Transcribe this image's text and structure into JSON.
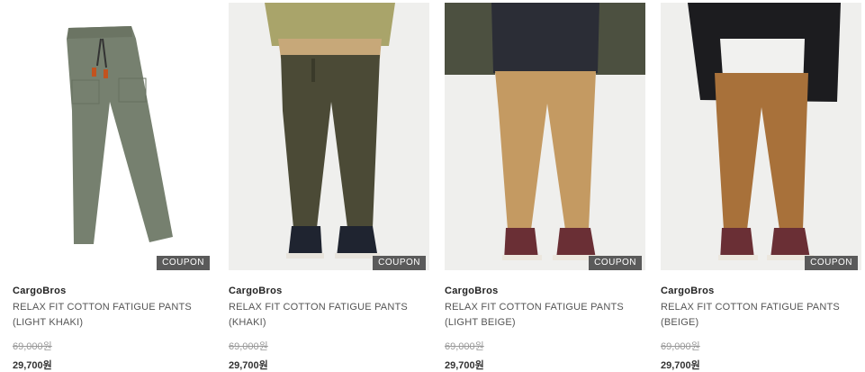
{
  "products": [
    {
      "brand": "CargoBros",
      "name": "RELAX FIT COTTON FATIGUE PANTS (LIGHT KHAKI)",
      "original_price": "69,000원",
      "sale_price": "29,700원",
      "badge": "COUPON",
      "pants_color": "#76806f",
      "image_style": "flat-lay"
    },
    {
      "brand": "CargoBros",
      "name": "RELAX FIT COTTON FATIGUE PANTS (KHAKI)",
      "original_price": "69,000원",
      "sale_price": "29,700원",
      "badge": "COUPON",
      "pants_color": "#4b4a36",
      "image_style": "worn"
    },
    {
      "brand": "CargoBros",
      "name": "RELAX FIT COTTON FATIGUE PANTS (LIGHT BEIGE)",
      "original_price": "69,000원",
      "sale_price": "29,700원",
      "badge": "COUPON",
      "pants_color": "#c49a62",
      "image_style": "worn"
    },
    {
      "brand": "CargoBros",
      "name": "RELAX FIT COTTON FATIGUE PANTS (BEIGE)",
      "original_price": "69,000원",
      "sale_price": "29,700원",
      "badge": "COUPON",
      "pants_color": "#a8713a",
      "image_style": "worn"
    }
  ]
}
